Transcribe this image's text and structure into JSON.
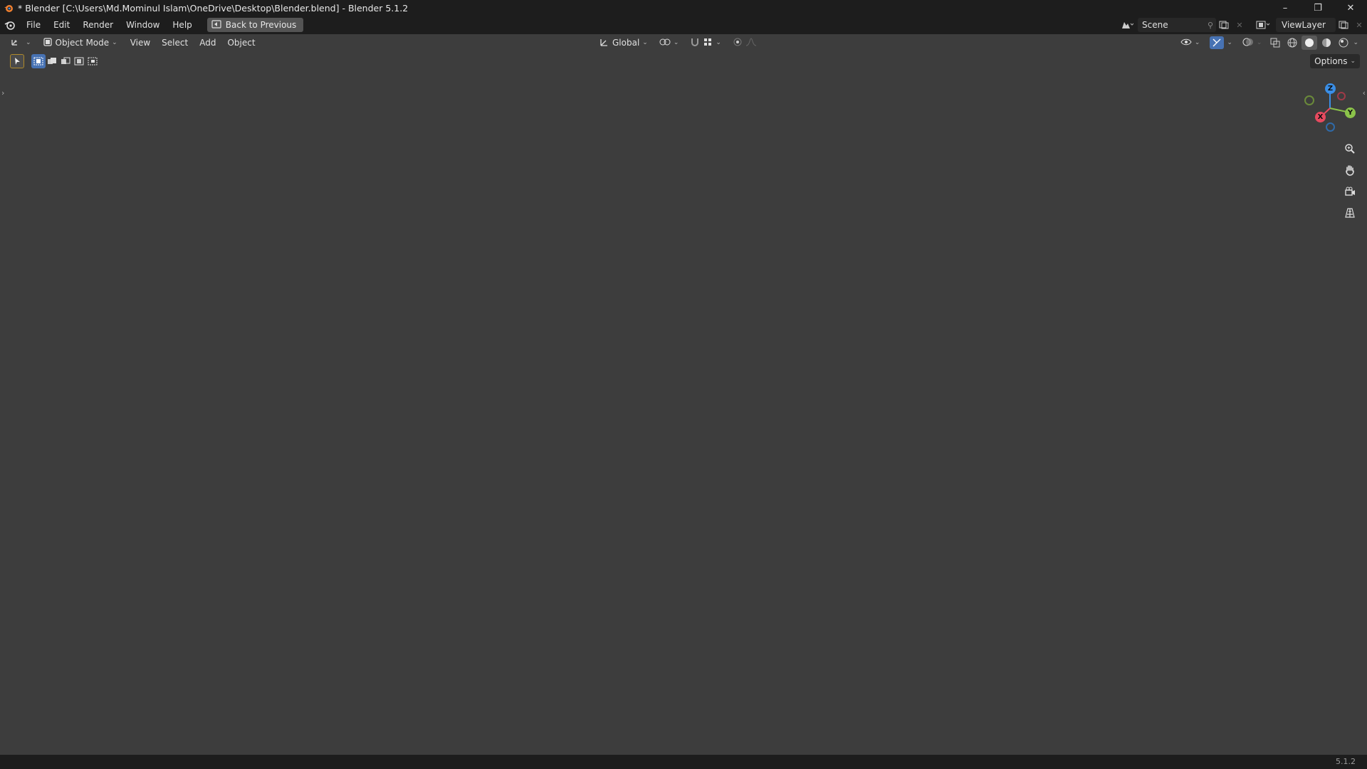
{
  "window": {
    "title": "* Blender [C:\\Users\\Md.Mominul Islam\\OneDrive\\Desktop\\Blender.blend] - Blender 5.1.2",
    "minimize": "–",
    "maximize": "❐",
    "close": "✕"
  },
  "menubar": {
    "items": [
      "File",
      "Edit",
      "Render",
      "Window",
      "Help"
    ],
    "back_button": "Back to Previous",
    "scene_label": "Scene",
    "viewlayer_label": "ViewLayer"
  },
  "viewport_header": {
    "mode": "Object Mode",
    "menus": [
      "View",
      "Select",
      "Add",
      "Object"
    ],
    "transform_orientation": "Global",
    "options": "Options"
  },
  "gizmo": {
    "z": "Z",
    "y": "Y",
    "x": "X",
    "colors": {
      "x": "#e84a5f",
      "y": "#8bc34a",
      "z": "#3a8ee6"
    }
  },
  "statusbar": {
    "version": "5.1.2"
  },
  "icons": {
    "app": "blender-icon",
    "editor_type": "3d-viewport-icon",
    "back": "back-to-previous-icon",
    "zoom": "zoom-icon",
    "pan": "hand-icon",
    "camera": "camera-icon",
    "grid": "perspective-grid-icon"
  }
}
